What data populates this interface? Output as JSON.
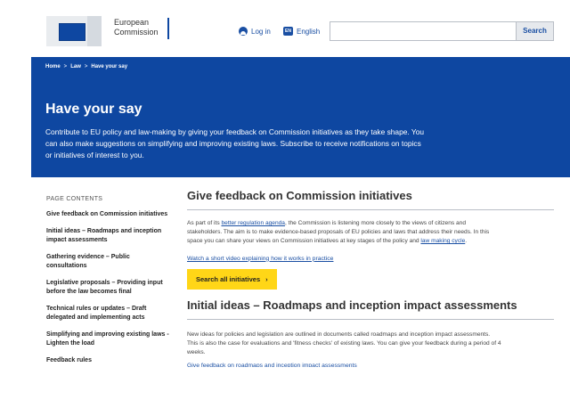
{
  "header": {
    "logo_line1": "European",
    "logo_line2": "Commission",
    "login": "Log in",
    "language_code": "EN",
    "language": "English",
    "search_placeholder": "",
    "search_button": "Search"
  },
  "breadcrumb": [
    "Home",
    "Law",
    "Have your say"
  ],
  "breadcrumb_sep": ">",
  "hero": {
    "title": "Have your say",
    "text": "Contribute to EU policy and law-making by giving your feedback on Commission initiatives as they take shape. You can also make suggestions on simplifying and improving existing laws. Subscribe to receive notifications on topics or initiatives of interest to you."
  },
  "sidebar": {
    "title": "PAGE CONTENTS",
    "items": [
      "Give feedback on Commission initiatives",
      "Initial ideas – Roadmaps and inception impact assessments",
      "Gathering evidence – Public consultations",
      "Legislative proposals – Providing input before the law becomes final",
      "Technical rules or updates – Draft delegated and implementing acts",
      "Simplifying and improving existing laws - Lighten the load",
      "Feedback rules"
    ]
  },
  "main": {
    "section1_title": "Give feedback on Commission initiatives",
    "p1_a": "As part of its ",
    "p1_link1": "better regulation agenda",
    "p1_b": ", the Commission is listening more closely to the views of citizens and stakeholders. The aim is to make evidence-based proposals of EU policies and laws that address their needs. In this space you can share your views on Commission initiatives at key stages of the policy and ",
    "p1_link2": "law making cycle",
    "p1_c": ".",
    "video_link": "Watch a short video explaining how it works in practice",
    "search_all_button": "Search all initiatives",
    "section2_title": "Initial ideas – Roadmaps and inception impact assessments",
    "p2": "New ideas for policies and legislation are outlined in documents called roadmaps and inception impact assessments. This is also the case for evaluations and 'fitness checks' of existing laws. You can give your feedback during a period of 4 weeks.",
    "roadmap_link": "Give feedback on roadmaps and inception impact assessments"
  },
  "colors": {
    "brand_blue": "#0e47a1",
    "button_yellow": "#ffd617",
    "link_blue": "#1a4fa3"
  }
}
